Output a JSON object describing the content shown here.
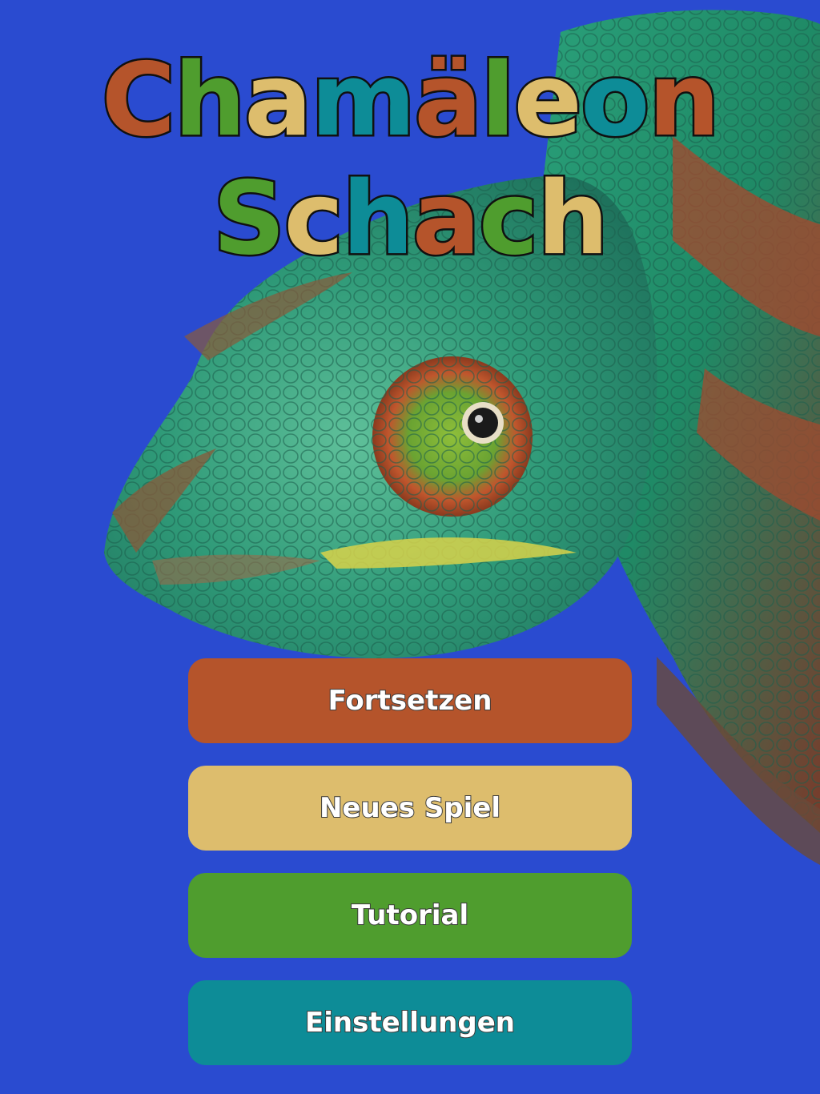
{
  "colors": {
    "background": "#2a4bd0",
    "rust": "#b5542b",
    "green": "#4f9d2e",
    "sand": "#ddbd6d",
    "teal": "#0d8c97"
  },
  "title": {
    "line1": [
      {
        "char": "C",
        "color": "#b5542b"
      },
      {
        "char": "h",
        "color": "#4f9d2e"
      },
      {
        "char": "a",
        "color": "#ddbd6d"
      },
      {
        "char": "m",
        "color": "#0d8c97"
      },
      {
        "char": "ä",
        "color": "#b5542b"
      },
      {
        "char": "l",
        "color": "#4f9d2e"
      },
      {
        "char": "e",
        "color": "#ddbd6d"
      },
      {
        "char": "o",
        "color": "#0d8c97"
      },
      {
        "char": "n",
        "color": "#b5542b"
      }
    ],
    "line2": [
      {
        "char": "S",
        "color": "#4f9d2e"
      },
      {
        "char": "c",
        "color": "#ddbd6d"
      },
      {
        "char": "h",
        "color": "#0d8c97"
      },
      {
        "char": "a",
        "color": "#b5542b"
      },
      {
        "char": "c",
        "color": "#4f9d2e"
      },
      {
        "char": "h",
        "color": "#ddbd6d"
      }
    ]
  },
  "background_image": "chameleon-photo",
  "menu": {
    "continue_label": "Fortsetzen",
    "new_game_label": "Neues Spiel",
    "tutorial_label": "Tutorial",
    "settings_label": "Einstellungen"
  }
}
